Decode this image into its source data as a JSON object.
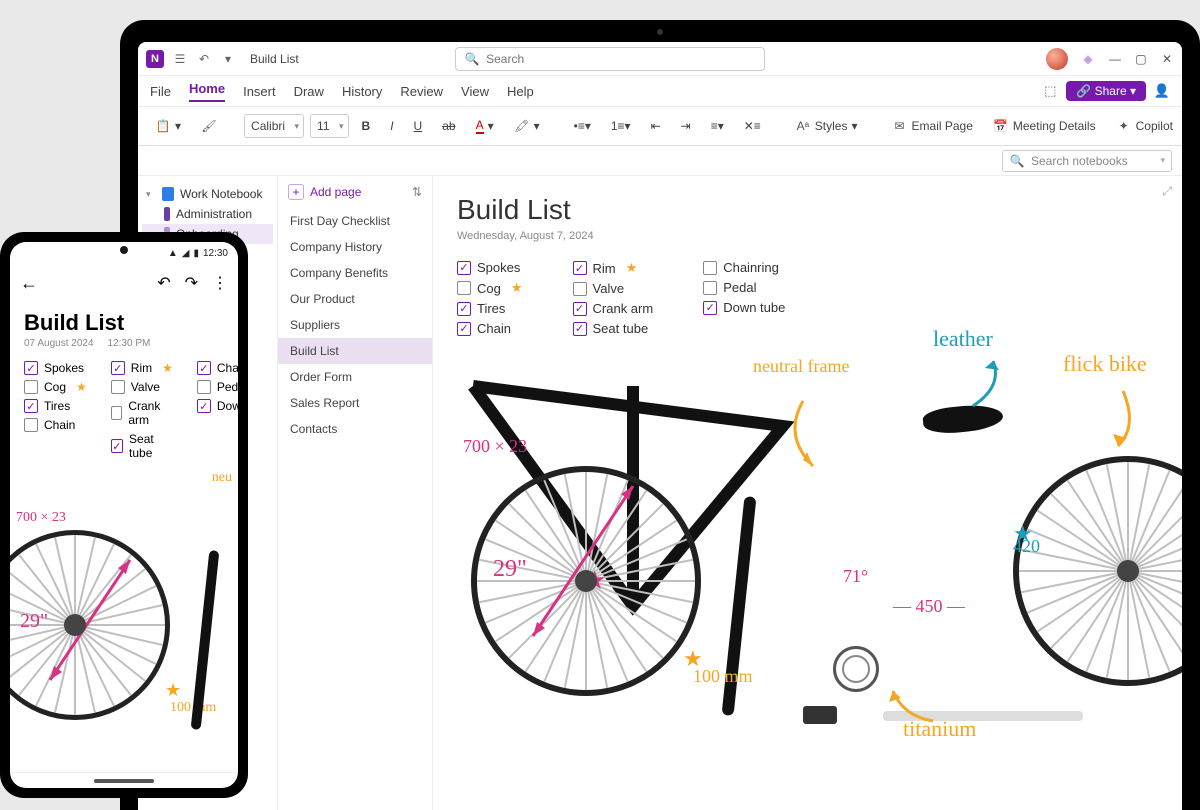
{
  "titlebar": {
    "doc_title": "Build List",
    "search_placeholder": "Search"
  },
  "menu": {
    "tabs": [
      "File",
      "Home",
      "Insert",
      "Draw",
      "History",
      "Review",
      "View",
      "Help"
    ],
    "active": "Home",
    "share_label": "Share"
  },
  "ribbon": {
    "font": "Calibri",
    "font_size": "11",
    "styles_label": "Styles",
    "email_label": "Email Page",
    "meeting_label": "Meeting Details",
    "copilot_label": "Copilot"
  },
  "notebook_search_placeholder": "Search notebooks",
  "tree": {
    "notebook": "Work Notebook",
    "sections": [
      {
        "label": "Administration",
        "color": "#6b3fa0"
      },
      {
        "label": "Onboarding",
        "color": "#b08dd8"
      }
    ]
  },
  "pages": {
    "add_label": "Add page",
    "items": [
      "First Day Checklist",
      "Company History",
      "Company Benefits",
      "Our Product",
      "Suppliers",
      "Build List",
      "Order Form",
      "Sales Report",
      "Contacts"
    ],
    "selected": "Build List"
  },
  "canvas": {
    "title": "Build List",
    "date": "Wednesday, August 7, 2024",
    "cols": [
      [
        {
          "label": "Spokes",
          "checked": true
        },
        {
          "label": "Cog",
          "checked": false,
          "star": true
        },
        {
          "label": "Tires",
          "checked": true
        },
        {
          "label": "Chain",
          "checked": true
        }
      ],
      [
        {
          "label": "Rim",
          "checked": true,
          "star": true
        },
        {
          "label": "Valve",
          "checked": false
        },
        {
          "label": "Crank arm",
          "checked": true
        },
        {
          "label": "Seat tube",
          "checked": true
        }
      ],
      [
        {
          "label": "Chainring",
          "checked": false
        },
        {
          "label": "Pedal",
          "checked": false
        },
        {
          "label": "Down tube",
          "checked": true
        }
      ]
    ],
    "annotations": {
      "dim1": "700 × 23",
      "spoke": "29\"",
      "frame": "neutral frame",
      "leather": "leather",
      "bike": "flick bike",
      "fork": "100 mm",
      "angle": "71°",
      "seat": "420",
      "tube": "450",
      "material": "titanium"
    }
  },
  "phone": {
    "clock": "12:30",
    "title": "Build List",
    "date": "07 August 2024",
    "time": "12:30 PM",
    "cols": [
      [
        {
          "label": "Spokes",
          "checked": true
        },
        {
          "label": "Cog",
          "checked": false,
          "star": true
        },
        {
          "label": "Tires",
          "checked": true
        },
        {
          "label": "Chain",
          "checked": false
        }
      ],
      [
        {
          "label": "Rim",
          "checked": true,
          "star": true
        },
        {
          "label": "Valve",
          "checked": false
        },
        {
          "label": "Crank arm",
          "checked": false
        },
        {
          "label": "Seat tube",
          "checked": true
        }
      ],
      [
        {
          "label": "Chai",
          "checked": true
        },
        {
          "label": "Peda",
          "checked": false
        },
        {
          "label": "Dow",
          "checked": true
        }
      ]
    ],
    "annotations": {
      "dim1": "700 × 23",
      "spoke": "29\"",
      "fork": "100 mm"
    }
  }
}
